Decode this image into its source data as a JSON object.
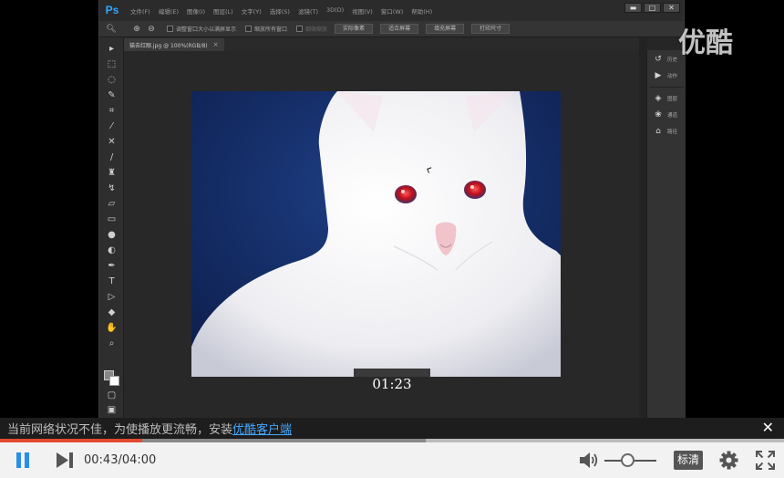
{
  "watermark": "优酷",
  "photoshop": {
    "logo": "Ps",
    "menu": [
      "文件(F)",
      "编辑(E)",
      "图像(I)",
      "图层(L)",
      "文字(Y)",
      "选择(S)",
      "滤镜(T)",
      "3D(D)",
      "视图(V)",
      "窗口(W)",
      "帮助(H)"
    ],
    "window_controls": [
      "▬",
      "□",
      "✕"
    ],
    "options": {
      "check1": "调整窗口大小以满屏显示",
      "check2": "缩放所有窗口",
      "check3": "细微缩放",
      "buttons": [
        "实际像素",
        "适合屏幕",
        "填充屏幕",
        "打印尺寸"
      ]
    },
    "doc_tab": "猫去红眼.jpg @ 100%(RGB/8)",
    "doc_tab_close": "×",
    "panels": [
      {
        "icon": "history-icon",
        "label": "历史"
      },
      {
        "icon": "actions-icon",
        "label": "动作"
      },
      {
        "icon": "layers-icon",
        "label": "图层"
      },
      {
        "icon": "channels-icon",
        "label": "通道"
      },
      {
        "icon": "paths-icon",
        "label": "路径"
      }
    ]
  },
  "seek_time": "01:23",
  "notice": {
    "text": "当前网络状况不佳，为使播放更流畅，安装",
    "link": "优酷客户端",
    "close": "✕"
  },
  "player": {
    "time_current": "00:43",
    "time_total": "04:00",
    "time_sep": "/",
    "quality": "标清",
    "progress_played": 0.181,
    "progress_buffered": 0.543,
    "volume": 0.45,
    "colors": {
      "accent": "#2b8ee6",
      "progress": "#e24a30",
      "link": "#43a7ff"
    }
  }
}
